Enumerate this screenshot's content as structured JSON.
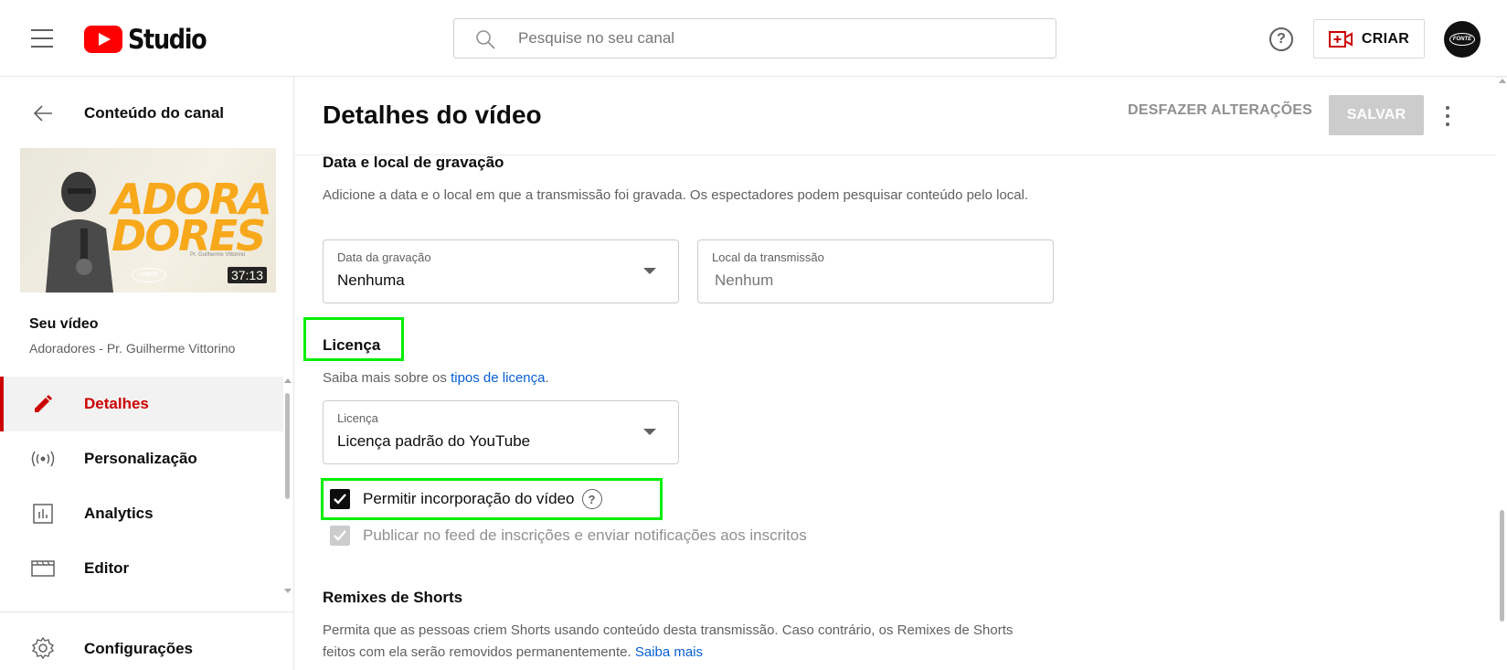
{
  "topbar": {
    "logo_text": "Studio",
    "search_placeholder": "Pesquise no seu canal",
    "help_glyph": "?",
    "create_label": "CRIAR",
    "avatar_text": "FONTE"
  },
  "sidebar": {
    "back_label": "Conteúdo do canal",
    "thumbnail": {
      "title": "ADORA DORES",
      "subtitle": "Pr. Guilherme Vittorino",
      "logo_text": "FONTE",
      "duration": "37:13"
    },
    "your_video_label": "Seu vídeo",
    "video_name": "Adoradores - Pr. Guilherme Vittorino",
    "items": [
      {
        "label": "Detalhes",
        "icon": "pencil-icon",
        "active": true
      },
      {
        "label": "Personalização",
        "icon": "broadcast-icon",
        "active": false
      },
      {
        "label": "Analytics",
        "icon": "analytics-icon",
        "active": false
      },
      {
        "label": "Editor",
        "icon": "clapper-icon",
        "active": false
      }
    ],
    "settings_label": "Configurações"
  },
  "main": {
    "title": "Detalhes do vídeo",
    "undo_label": "DESFAZER ALTERAÇÕES",
    "save_label": "SALVAR",
    "recording": {
      "title": "Data e local de gravação",
      "description": "Adicione a data e o local em que a transmissão foi gravada. Os espectadores podem pesquisar conteúdo pelo local.",
      "date_label": "Data da gravação",
      "date_value": "Nenhuma",
      "location_label": "Local da transmissão",
      "location_placeholder": "Nenhum"
    },
    "license": {
      "title": "Licença",
      "desc_prefix": "Saiba mais sobre os ",
      "desc_link": "tipos de licença",
      "desc_suffix": ".",
      "field_label": "Licença",
      "field_value": "Licença padrão do YouTube"
    },
    "checkboxes": {
      "embed_label": "Permitir incorporação do vídeo",
      "embed_checked": true,
      "feed_label": "Publicar no feed de inscrições e enviar notificações aos inscritos",
      "feed_checked": true,
      "feed_disabled": true
    },
    "shorts": {
      "title": "Remixes de Shorts",
      "description": "Permita que as pessoas criem Shorts usando conteúdo desta transmissão. Caso contrário, os Remixes de Shorts feitos com ela serão removidos permanentemente. ",
      "link": "Saiba mais"
    }
  },
  "colors": {
    "accent_red": "#cc0000",
    "link_blue": "#065fd4",
    "highlight_green": "#00ee00",
    "thumbnail_title": "#f7a81b"
  }
}
